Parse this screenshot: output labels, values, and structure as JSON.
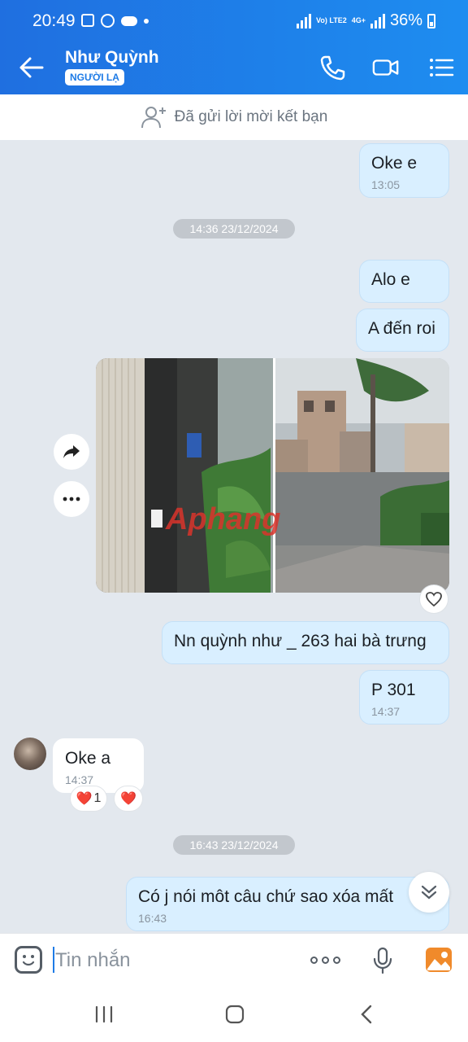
{
  "status_bar": {
    "time": "20:49",
    "network": "Vo) LTE2",
    "network_type": "4G+",
    "battery": "36%"
  },
  "header": {
    "contact_name": "Như Quỳnh",
    "badge": "NGƯỜI LẠ",
    "icons": [
      "back-arrow-icon",
      "phone-icon",
      "video-call-icon",
      "menu-list-icon"
    ]
  },
  "friend_request": {
    "text": "Đã gửi lời mời kết bạn",
    "icon": "add-user-icon"
  },
  "messages": [
    {
      "id": "m1",
      "side": "out",
      "text": "Oke e",
      "time": "13:05"
    },
    {
      "id": "d1",
      "type": "date",
      "text": "14:36 23/12/2024"
    },
    {
      "id": "m2",
      "side": "out",
      "text": "Alo e"
    },
    {
      "id": "m3",
      "side": "out",
      "text": "A đến roi"
    },
    {
      "id": "m4",
      "side": "out",
      "type": "photo",
      "watermark": "Aphang"
    },
    {
      "id": "m5",
      "side": "out",
      "text": "Nn quỳnh như _ 263 hai bà trưng"
    },
    {
      "id": "m6",
      "side": "out",
      "text": "P 301",
      "time": "14:37"
    },
    {
      "id": "m7",
      "side": "in",
      "text": "Oke a",
      "time": "14:37",
      "reactions": [
        {
          "emoji": "❤️",
          "count": "1"
        },
        {
          "emoji": "❤️"
        }
      ]
    },
    {
      "id": "d2",
      "type": "date",
      "text": "16:43 23/12/2024"
    },
    {
      "id": "m8",
      "side": "out",
      "text": "Có j nói môt câu chứ sao xóa mất",
      "time": "16:43"
    }
  ],
  "input": {
    "placeholder": "Tin nhắn",
    "icons": [
      "emoji-icon",
      "more-dots-icon",
      "microphone-icon",
      "image-icon"
    ]
  },
  "colors": {
    "header": "#1e7be6",
    "bubble_out": "#d9efff",
    "background": "#e3e8ee",
    "date_pill": "#c2c7cd"
  }
}
